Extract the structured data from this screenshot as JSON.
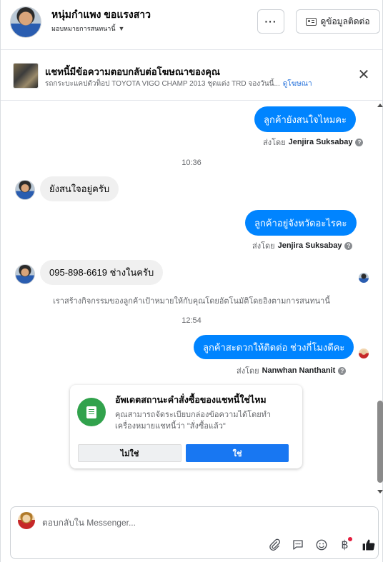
{
  "header": {
    "name": "หนุ่มกำแพง ขอแรงสาว",
    "assign_label": "มอบหมายการสนทนานี้",
    "more_label": "···",
    "contact_label": "ดูข้อมูลติดต่อ"
  },
  "ad_banner": {
    "title": "แชทนี้มีข้อความตอบกลับต่อโฆษณาของคุณ",
    "subtitle": "รถกระบะแคปตัวท็อป TOYOTA VIGO CHAMP 2013 ชุดแต่ง TRD จองวันนี้...",
    "link": "ดูโฆษณา",
    "close": "✕"
  },
  "messages": [
    {
      "id": "m1",
      "text": "ลูกค้ายังสนใจไหมคะ",
      "sent_by_prefix": "ส่งโดย",
      "sent_by": "Jenjira Suksabay"
    },
    {
      "id": "ts1",
      "text": "10:36"
    },
    {
      "id": "m2",
      "text": "ยังสนใจอยู่ครับ"
    },
    {
      "id": "m3",
      "text": "ลูกค้าอยู่จังหวัดอะไรคะ",
      "sent_by_prefix": "ส่งโดย",
      "sent_by": "Jenjira Suksabay"
    },
    {
      "id": "m4",
      "text": "095-898-6619 ช่างในครับ"
    },
    {
      "id": "note",
      "text": "เราสร้างกิจกรรมของลูกค้าเป้าหมายให้กับคุณโดยอัตโนมัติโดยอิงตามการสนทนานี้"
    },
    {
      "id": "ts2",
      "text": "12:54"
    },
    {
      "id": "m5",
      "text": "ลูกค้าสะดวกให้ติดต่อ ช่วงกี่โมงดีคะ",
      "sent_by_prefix": "ส่งโดย",
      "sent_by": "Nanwhan Nanthanit"
    }
  ],
  "info_glyph": "?",
  "order_card": {
    "title": "อัพเดตสถานะคำสั่งซื้อของแชทนี้ใช่ไหม",
    "body": "คุณสามารถจัดระเบียบกล่องข้อความได้โดยทำเครื่องหมายแชทนี้ว่า \"สั่งซื้อแล้ว\"",
    "no_label": "ไม่ใช่",
    "yes_label": "ใช่"
  },
  "composer": {
    "placeholder": "ตอบกลับใน Messenger...",
    "tools": [
      "attach-icon",
      "saved-reply-icon",
      "emoji-icon",
      "baht-icon",
      "like-icon"
    ],
    "baht_glyph": "฿"
  },
  "colors": {
    "outgoing_bubble": "#0084ff",
    "incoming_bubble": "#f0f0f0",
    "primary_button": "#1877f2",
    "order_icon": "#31a24c",
    "link": "#216fdb"
  }
}
